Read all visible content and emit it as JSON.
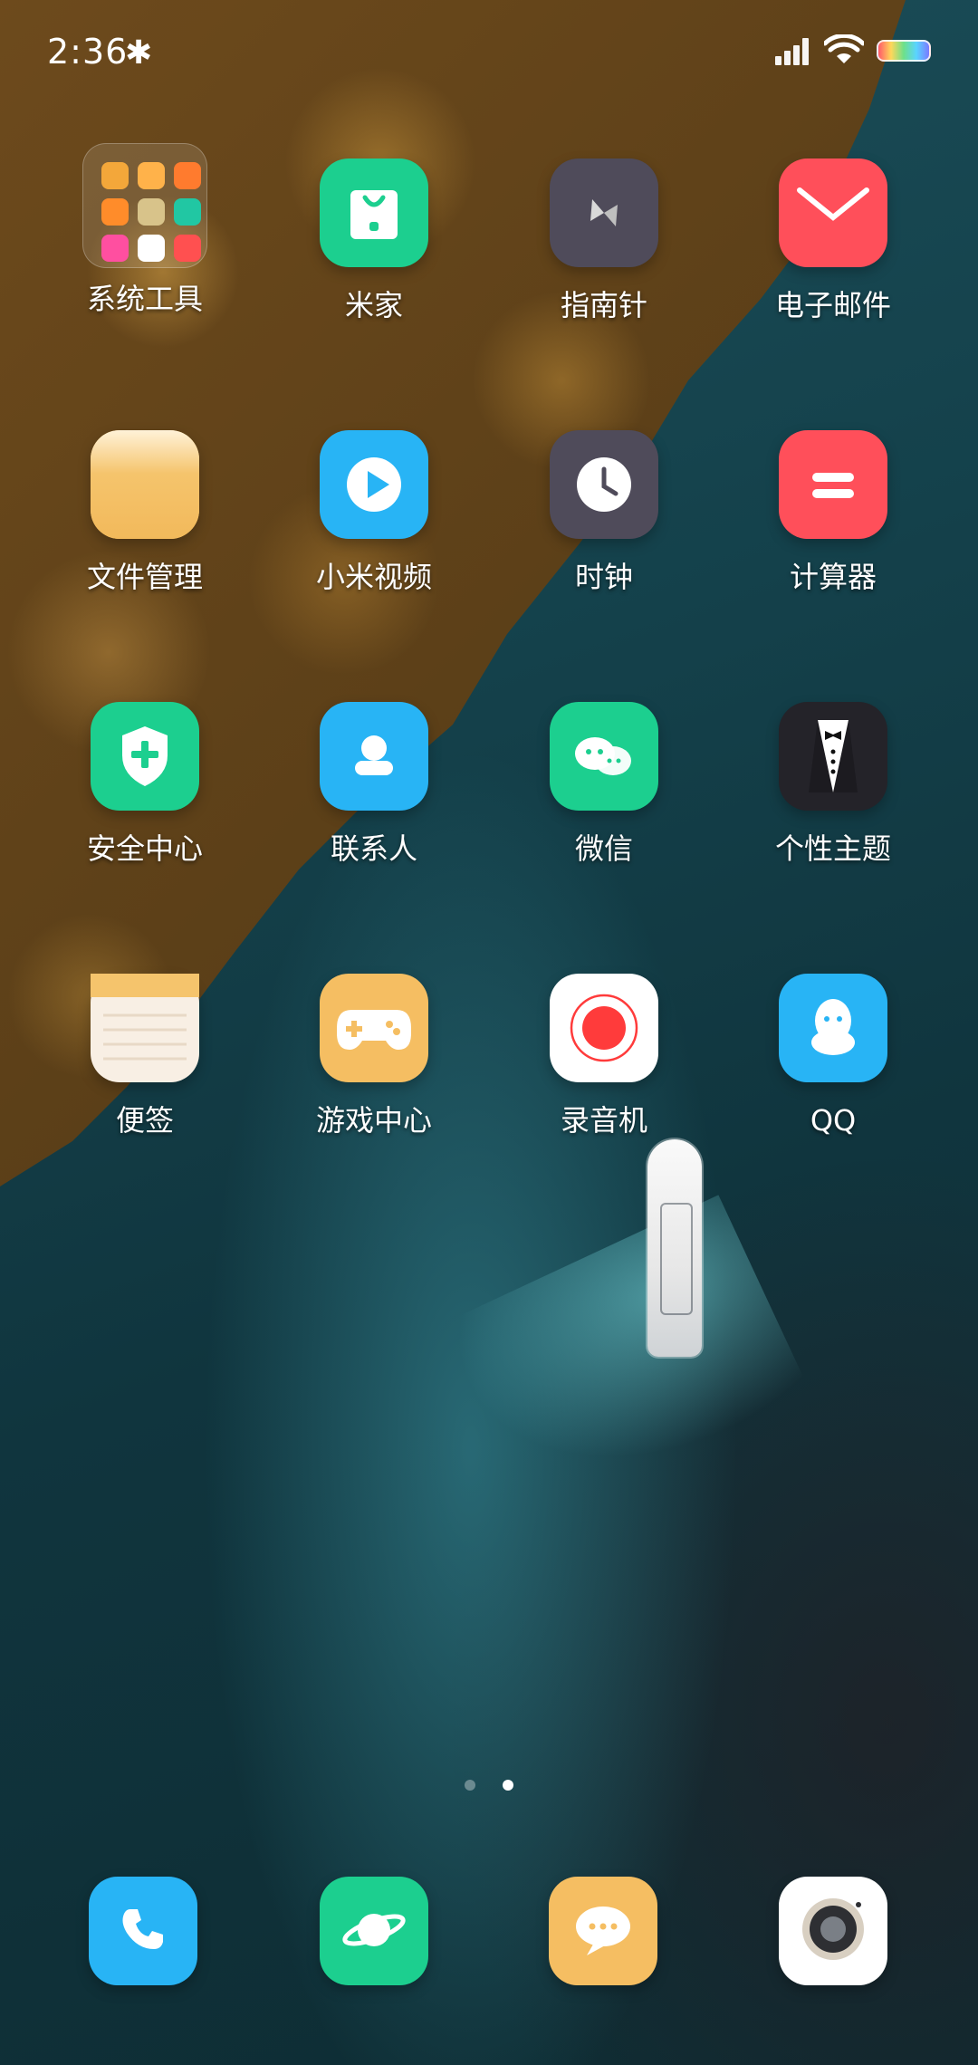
{
  "status": {
    "time": "2:36",
    "bluetooth": "bluetooth-icon",
    "signal": "signal-icon",
    "wifi": "wifi-icon",
    "battery": "battery-icon"
  },
  "apps": [
    {
      "label": "系统工具",
      "icon": "folder-icon"
    },
    {
      "label": "米家",
      "icon": "mijia-icon",
      "color": "#1ccf8f"
    },
    {
      "label": "指南针",
      "icon": "compass-icon",
      "color": "#4f4b5a"
    },
    {
      "label": "电子邮件",
      "icon": "mail-icon",
      "color": "#ff4f5a"
    },
    {
      "label": "文件管理",
      "icon": "file-manager-icon",
      "color": "#f5c46c"
    },
    {
      "label": "小米视频",
      "icon": "video-icon",
      "color": "#28b4f5"
    },
    {
      "label": "时钟",
      "icon": "clock-icon",
      "color": "#4f4b5a"
    },
    {
      "label": "计算器",
      "icon": "calculator-icon",
      "color": "#ff4f5a"
    },
    {
      "label": "安全中心",
      "icon": "security-icon",
      "color": "#1ccf8f"
    },
    {
      "label": "联系人",
      "icon": "contacts-icon",
      "color": "#28b4f5"
    },
    {
      "label": "微信",
      "icon": "wechat-icon",
      "color": "#1ccf8f"
    },
    {
      "label": "个性主题",
      "icon": "theme-icon",
      "color": "#242329"
    },
    {
      "label": "便签",
      "icon": "notes-icon",
      "color": "#f8efe4"
    },
    {
      "label": "游戏中心",
      "icon": "game-icon",
      "color": "#f5be62"
    },
    {
      "label": "录音机",
      "icon": "recorder-icon",
      "color": "#ffffff"
    },
    {
      "label": "QQ",
      "icon": "qq-icon",
      "color": "#28b4f5"
    }
  ],
  "page_indicator": {
    "total": 2,
    "active": 2
  },
  "dock": [
    {
      "icon": "phone-icon",
      "color": "#28b4f5"
    },
    {
      "icon": "browser-icon",
      "color": "#1ccf8f"
    },
    {
      "icon": "messages-icon",
      "color": "#f5be62"
    },
    {
      "icon": "camera-icon",
      "color": "#ffffff"
    }
  ]
}
